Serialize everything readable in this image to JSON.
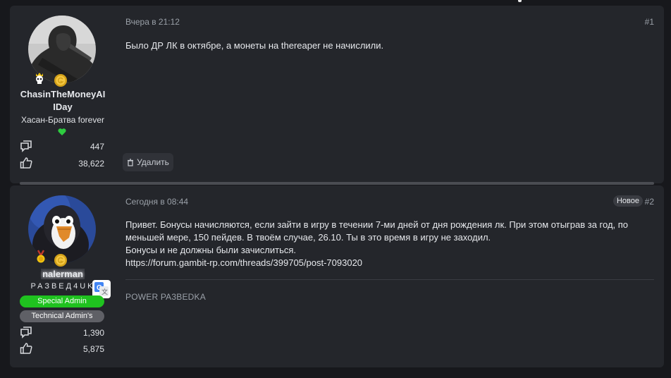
{
  "posts": [
    {
      "username_line1": "ChasinTheMoneyAI",
      "username_line2": "IDay",
      "user_title": "Хасан-Братва forever",
      "messages_count": "447",
      "reactions_count": "38,622",
      "date": "Вчера в 21:12",
      "number": "#1",
      "text": "Было ДР ЛК в октябре, а монеты на thereaper не начислили.",
      "delete_label": "Удалить",
      "colors": {
        "heart": "#2ecc40"
      }
    },
    {
      "username": "nalerman",
      "user_title": "РАЗВЕД4UK",
      "banner_1": "Special Admin",
      "banner_2": "Technical Admin's",
      "messages_count": "1,390",
      "reactions_count": "5,875",
      "date": "Сегодня в 08:44",
      "new_label": "Новое",
      "number": "#2",
      "text_line1": "Привет. Бонусы начисляются, если зайти в игру в течении 7-ми дней от дня рождения лк. При этом отыграв за год, по",
      "text_line2": "меньшей мере, 150 пейдев. В твоём случае, 26.10. Ты в это время в игру не заходил.",
      "text_line3": "Бонусы и не должны были зачислиться.",
      "link": "https://forum.gambit-rp.com/threads/399705/post-7093020",
      "signature": "POWER PA3BEDKA",
      "colors": {
        "banner_1": "#1fc21f",
        "banner_2": "#5f6066"
      }
    }
  ]
}
